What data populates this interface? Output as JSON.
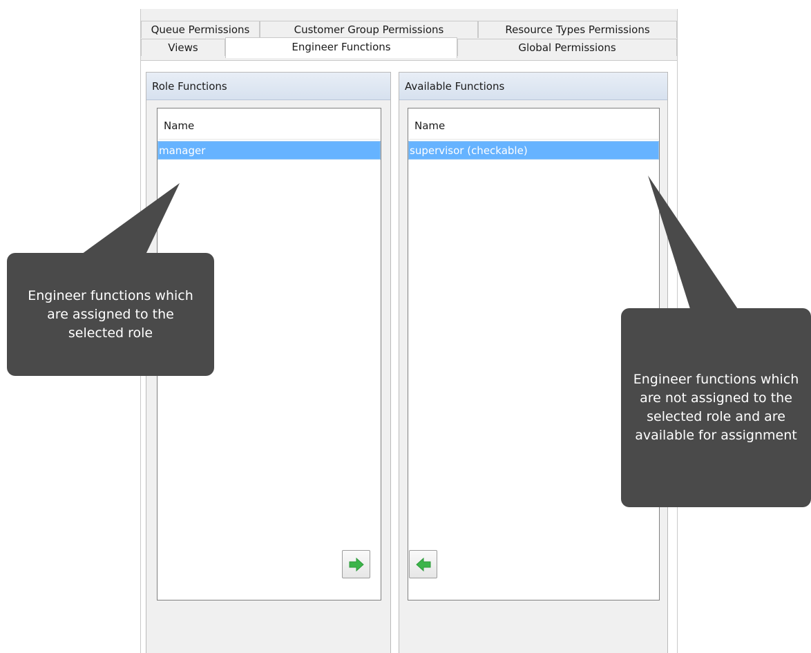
{
  "tabs": {
    "row1": [
      "Queue Permissions",
      "Customer Group Permissions",
      "Resource Types Permissions"
    ],
    "row2": [
      "Views",
      "Engineer Functions",
      "Global Permissions"
    ],
    "active": "Engineer Functions"
  },
  "left_panel": {
    "title": "Role Functions",
    "column_header": "Name",
    "items": [
      "manager"
    ],
    "button_icon": "arrow-right-icon"
  },
  "right_panel": {
    "title": "Available Functions",
    "column_header": "Name",
    "items": [
      "supervisor (checkable)"
    ],
    "button_icon": "arrow-left-icon"
  },
  "callouts": {
    "left": "Engineer functions which are assigned to the selected role",
    "right": "Engineer functions which are not assigned to the selected role and are available for assignment"
  },
  "colors": {
    "selection": "#66b3ff",
    "arrow": "#3cb44a",
    "callout": "#4a4a4a"
  }
}
